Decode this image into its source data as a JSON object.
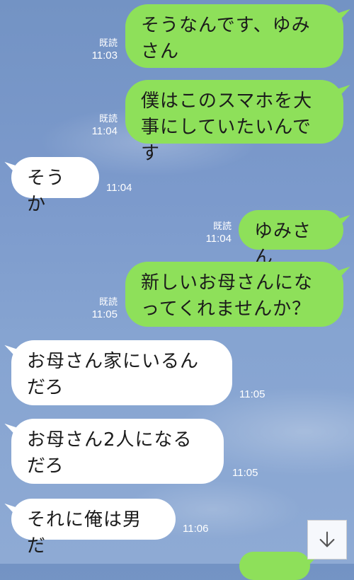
{
  "messages": [
    {
      "side": "out",
      "text": "そうなんです、ゆみさん",
      "read": "既読",
      "time": "11:03"
    },
    {
      "side": "out",
      "text": "僕はこのスマホを大事にしていたいんです",
      "read": "既読",
      "time": "11:04"
    },
    {
      "side": "in",
      "text": "そうか",
      "time": "11:04"
    },
    {
      "side": "out",
      "text": "ゆみさん",
      "read": "既読",
      "time": "11:04"
    },
    {
      "side": "out",
      "text": "新しいお母さんになってくれませんか？",
      "read": "既読",
      "time": "11:05"
    },
    {
      "side": "in",
      "text": "お母さん家にいるんだろ",
      "time": "11:05"
    },
    {
      "side": "in",
      "text": "お母さん2人になるだろ",
      "time": "11:05"
    },
    {
      "side": "in",
      "text": "それに俺は男だ",
      "time": "11:06"
    }
  ],
  "scroll_button": {
    "icon": "arrow-down-icon"
  },
  "colors": {
    "background": "#7c9acc",
    "outgoing_bubble": "#8ee05a",
    "incoming_bubble": "#ffffff",
    "meta_text": "#ffffff"
  }
}
